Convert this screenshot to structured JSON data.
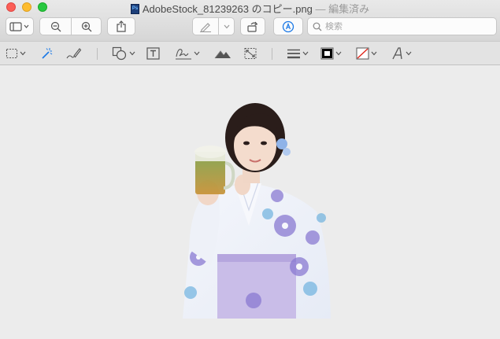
{
  "window": {
    "filename": "AdobeStock_81239263 のコピー.png",
    "separator": " — ",
    "status": "編集済み"
  },
  "toolbar": {
    "sidebar_button": "sidebar-toggle",
    "zoom_out": "zoom-out",
    "zoom_in": "zoom-in",
    "share": "share",
    "markup_pen": "pen",
    "rotate": "rotate",
    "markup_toggle": "markup"
  },
  "search": {
    "placeholder": "検索",
    "value": ""
  },
  "markup_tools": [
    "rectangular-selection",
    "instant-alpha",
    "sketch",
    "shapes",
    "text",
    "sign",
    "adjust-color",
    "adjust-size",
    "shape-style",
    "border-color",
    "fill-color",
    "text-style"
  ],
  "colors": {
    "border_color": "#000000",
    "fill_color": "none",
    "canvas_bg": "#ececec"
  },
  "image": {
    "subject": "woman in floral yukata holding beer mug"
  }
}
